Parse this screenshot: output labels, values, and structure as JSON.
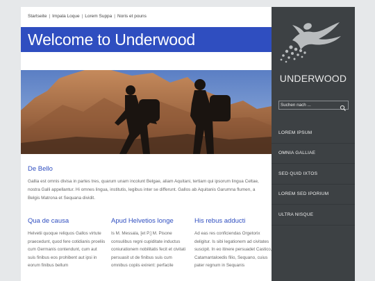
{
  "breadcrumb": {
    "items": [
      "Startseite",
      "Impala Loque",
      "Lorem Suppa",
      "Noris et pouns"
    ],
    "separator": "|"
  },
  "header": {
    "title": "Welcome to Underwood"
  },
  "intro": {
    "heading": "De Bello",
    "text": "Gallia est omnis divisa in partes tres, quarum unam incolunt Belgae, aliam Aquitani, tertiam qui ipsorum lingua Celtae, nostra Galli appellantur. Hi omnes lingua, institutis, legibus inter se differunt. Gallos ab Aquitanis Garumna flumen, a Belgis Matrona et Sequana dividit."
  },
  "columns": [
    {
      "heading": "Qua de causa",
      "text": "Helvetii quoque reliquos Gallos virtute praecedunt, quod fere cotidianis proeliis cum Germanis contendunt, cum aut suis finibus eos prohibent aut ipsi in eorum finibus bellum"
    },
    {
      "heading": "Apud Helvetios longe",
      "text": "Is M. Messala, [et P.] M. Pisone consulibus regni cupiditate inductus coniurationem nobilitatis fecit et civitati persuasit ut de finibus suis cum omnibus copiis exirent: perfacile"
    },
    {
      "heading": "His rebus adducti",
      "text": "Ad eas res conficiendas Orgetorix deligitur. Is sibi legationem ad civitates suscipit. In eo itinere persuadet Castico, Catamantaloedis filio, Sequano, cuius pater regnum in Sequanis"
    }
  ],
  "sidebar": {
    "logo_text": "UNDERWOOD",
    "search": {
      "placeholder": "Suchen nach ..."
    },
    "search_icon": "magnifier-icon",
    "nav": [
      "LOREM IPSUM",
      "OMNIA GALLIAE",
      "SED QUID IXTOS",
      "LOREM SED IPORIUM",
      "ULTRA NISQUE"
    ]
  },
  "colors": {
    "accent": "#2f4ec0",
    "sidebar_bg": "#3d4144",
    "page_bg": "#e6e8ea"
  }
}
